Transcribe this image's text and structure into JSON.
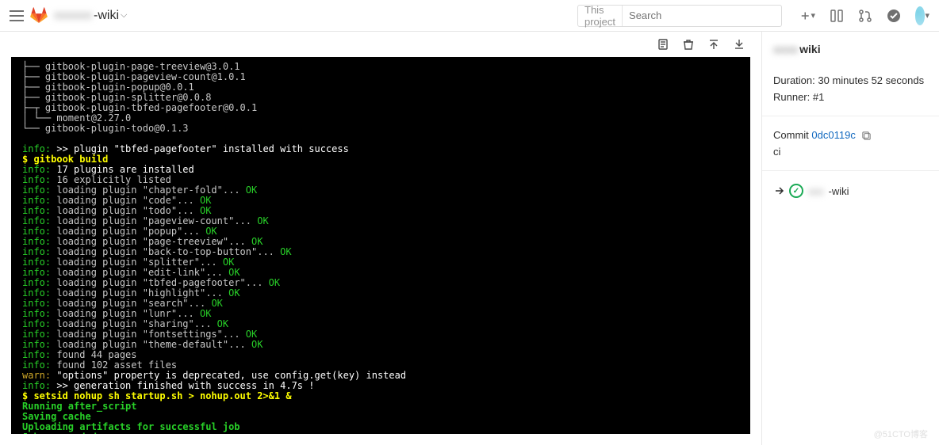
{
  "header": {
    "project_suffix": "-wiki",
    "search_scope": "This project",
    "search_placeholder": "Search"
  },
  "toolbar_icons": [
    "raw-log",
    "erase-log",
    "scroll-top",
    "scroll-bottom"
  ],
  "terminal": {
    "tree": [
      "├── gitbook-plugin-page-treeview@3.0.1",
      "├── gitbook-plugin-pageview-count@1.0.1",
      "├── gitbook-plugin-popup@0.0.1",
      "├── gitbook-plugin-splitter@0.0.8",
      "├─┬ gitbook-plugin-tbfed-pagefooter@0.0.1",
      "│ └── moment@2.27.0",
      "└── gitbook-plugin-todo@0.1.3"
    ],
    "install_success": ">> plugin \"tbfed-pagefooter\" installed with success",
    "build_cmd": "$ gitbook build",
    "plugins_installed": "17 plugins are installed",
    "plugins_listed": "16 explicitly listed",
    "loading": [
      "chapter-fold",
      "code",
      "todo",
      "pageview-count",
      "popup",
      "page-treeview",
      "back-to-top-button",
      "splitter",
      "edit-link",
      "tbfed-pagefooter",
      "highlight",
      "search",
      "lunr",
      "sharing",
      "fontsettings",
      "theme-default"
    ],
    "found_pages": "found 44 pages",
    "found_assets": "found 102 asset files",
    "warn_options": "\"options\" property is deprecated, use config.get(key) instead",
    "gen_success": ">> generation finished with success in 4.7s !",
    "setsid_cmd": "$ setsid nohup sh startup.sh > nohup.out 2>&1 &",
    "after_script": "Running after_script",
    "saving_cache": "Saving cache",
    "uploading": "Uploading artifacts for successful job",
    "succeeded": "Job succeeded"
  },
  "side": {
    "title_suffix": "wiki",
    "duration_label": "Duration:",
    "duration_value": "30 minutes 52 seconds",
    "runner_label": "Runner:",
    "runner_value": "#1",
    "commit_label": "Commit",
    "commit_hash": "0dc0119c",
    "commit_msg": "ci",
    "pipeline_suffix": "-wiki"
  },
  "watermark": "@51CTO博客"
}
